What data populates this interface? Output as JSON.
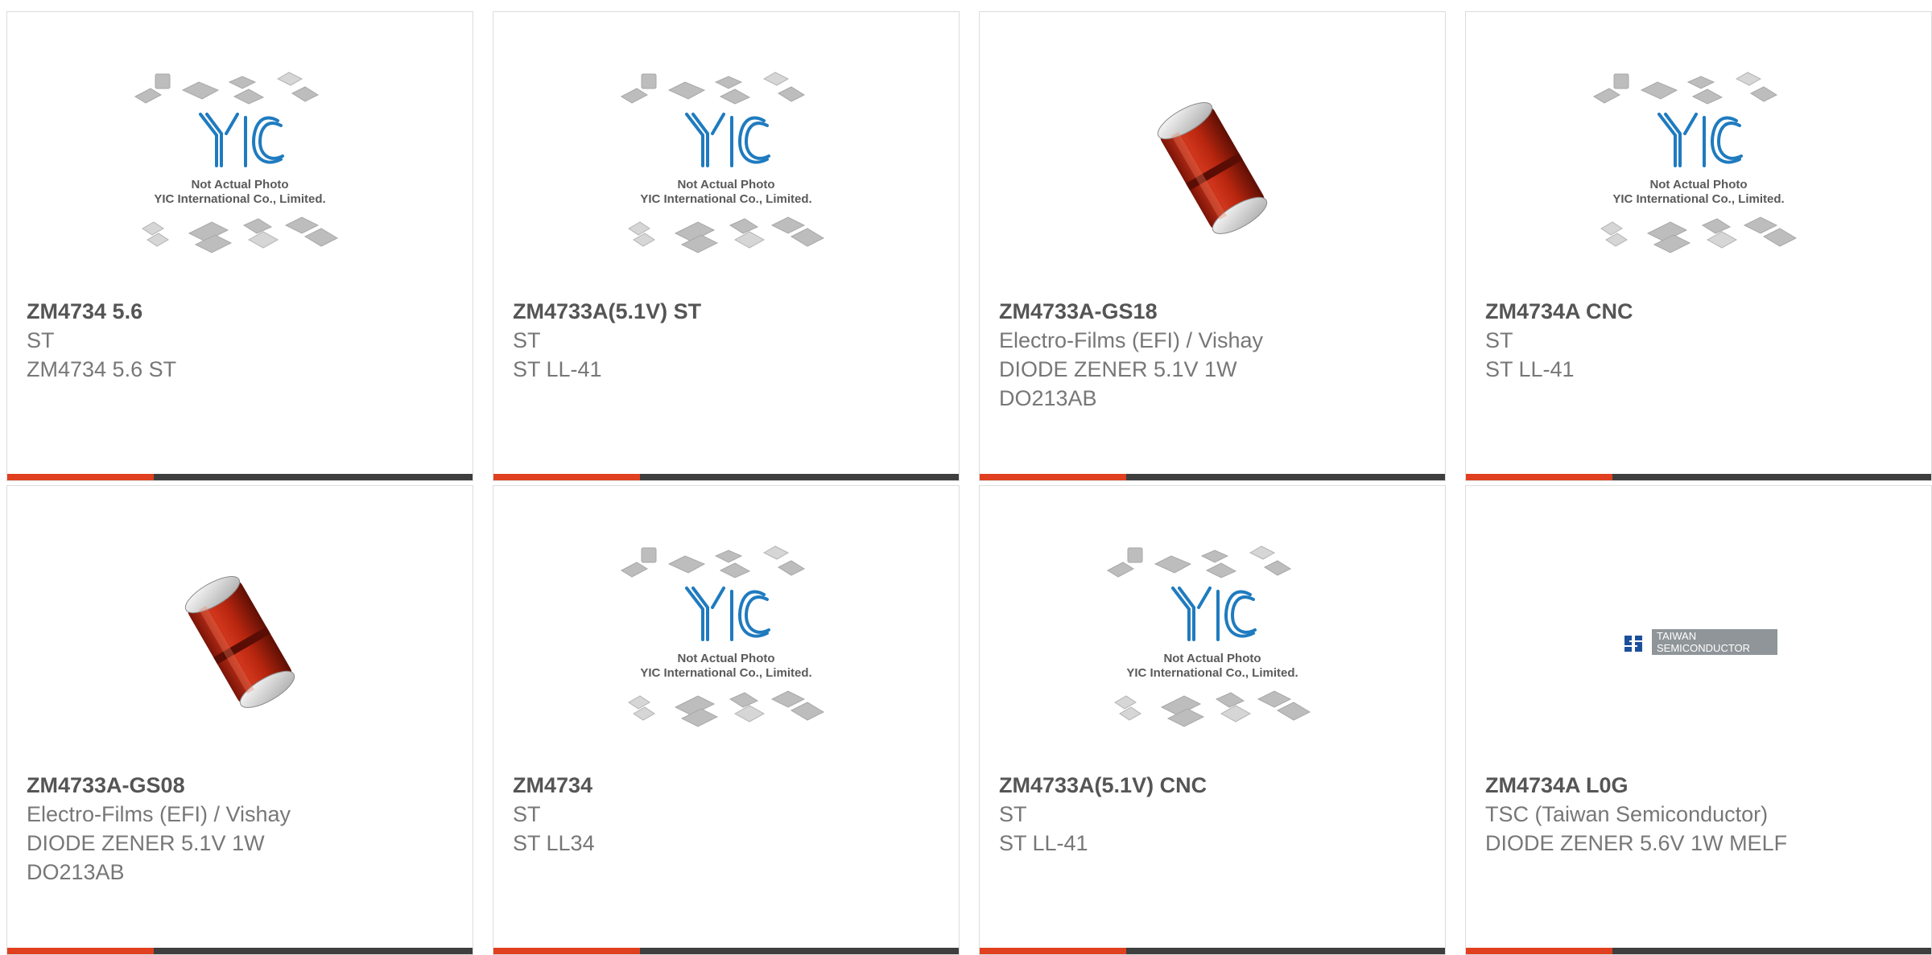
{
  "theme": {
    "accent": "#e0401f",
    "bar_dark": "#3e3e3e",
    "title_color": "#555555",
    "text_color": "#777777"
  },
  "placeholder": {
    "line1": "Not Actual Photo",
    "line2": "YIC International Co., Limited.",
    "logo_text": "YIC"
  },
  "tsc_logo": {
    "line1": "TAIWAN",
    "line2": "SEMICONDUCTOR"
  },
  "products": [
    {
      "title": "ZM4734 5.6",
      "image": "placeholder",
      "lines": [
        "ST",
        "ZM4734 5.6 ST"
      ]
    },
    {
      "title": "ZM4733A(5.1V) ST",
      "image": "placeholder",
      "lines": [
        "ST",
        "ST LL-41"
      ]
    },
    {
      "title": "ZM4733A-GS18",
      "image": "melf-diode",
      "lines": [
        "Electro-Films (EFI) / Vishay",
        "DIODE ZENER 5.1V 1W",
        "DO213AB"
      ]
    },
    {
      "title": "ZM4734A CNC",
      "image": "placeholder",
      "lines": [
        "ST",
        "ST LL-41"
      ]
    },
    {
      "title": "ZM4733A-GS08",
      "image": "melf-diode",
      "lines": [
        "Electro-Films (EFI) / Vishay",
        "DIODE ZENER 5.1V 1W",
        "DO213AB"
      ]
    },
    {
      "title": "ZM4734",
      "image": "placeholder",
      "lines": [
        "ST",
        "ST LL34"
      ]
    },
    {
      "title": "ZM4733A(5.1V) CNC",
      "image": "placeholder",
      "lines": [
        "ST",
        "ST LL-41"
      ]
    },
    {
      "title": "ZM4734A L0G",
      "image": "tsc-logo",
      "lines": [
        "TSC (Taiwan Semiconductor)",
        "DIODE ZENER 5.6V 1W MELF"
      ]
    }
  ]
}
